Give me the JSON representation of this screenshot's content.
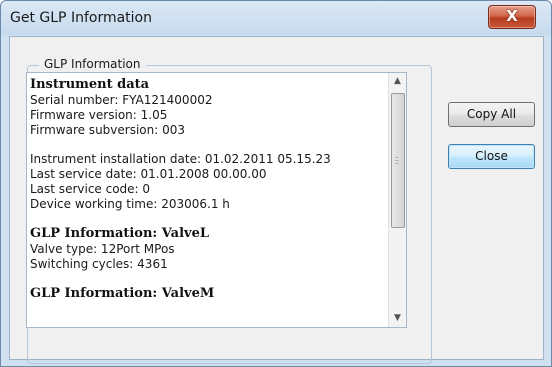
{
  "window": {
    "title": "Get GLP Information",
    "close_glyph": "X"
  },
  "group": {
    "legend": "GLP Information"
  },
  "text": {
    "lines": [
      {
        "kind": "head",
        "text": "Instrument data"
      },
      {
        "kind": "line",
        "text": "Serial number: FYA121400002"
      },
      {
        "kind": "line",
        "text": "Firmware version: 1.05"
      },
      {
        "kind": "line",
        "text": "Firmware subversion: 003"
      },
      {
        "kind": "gap"
      },
      {
        "kind": "line",
        "text": "Instrument installation date: 01.02.2011 05.15.23"
      },
      {
        "kind": "line",
        "text": "Last service date: 01.01.2008 00.00.00"
      },
      {
        "kind": "line",
        "text": "Last service code: 0"
      },
      {
        "kind": "line",
        "text": "Device working time: 203006.1 h"
      },
      {
        "kind": "gap"
      },
      {
        "kind": "head",
        "text": "GLP Information: ValveL"
      },
      {
        "kind": "line",
        "text": "Valve type: 12Port MPos"
      },
      {
        "kind": "line",
        "text": "Switching cycles: 4361"
      },
      {
        "kind": "gap"
      },
      {
        "kind": "head",
        "text": "GLP Information: ValveM"
      }
    ]
  },
  "buttons": {
    "copy_all": "Copy All",
    "close": "Close"
  }
}
